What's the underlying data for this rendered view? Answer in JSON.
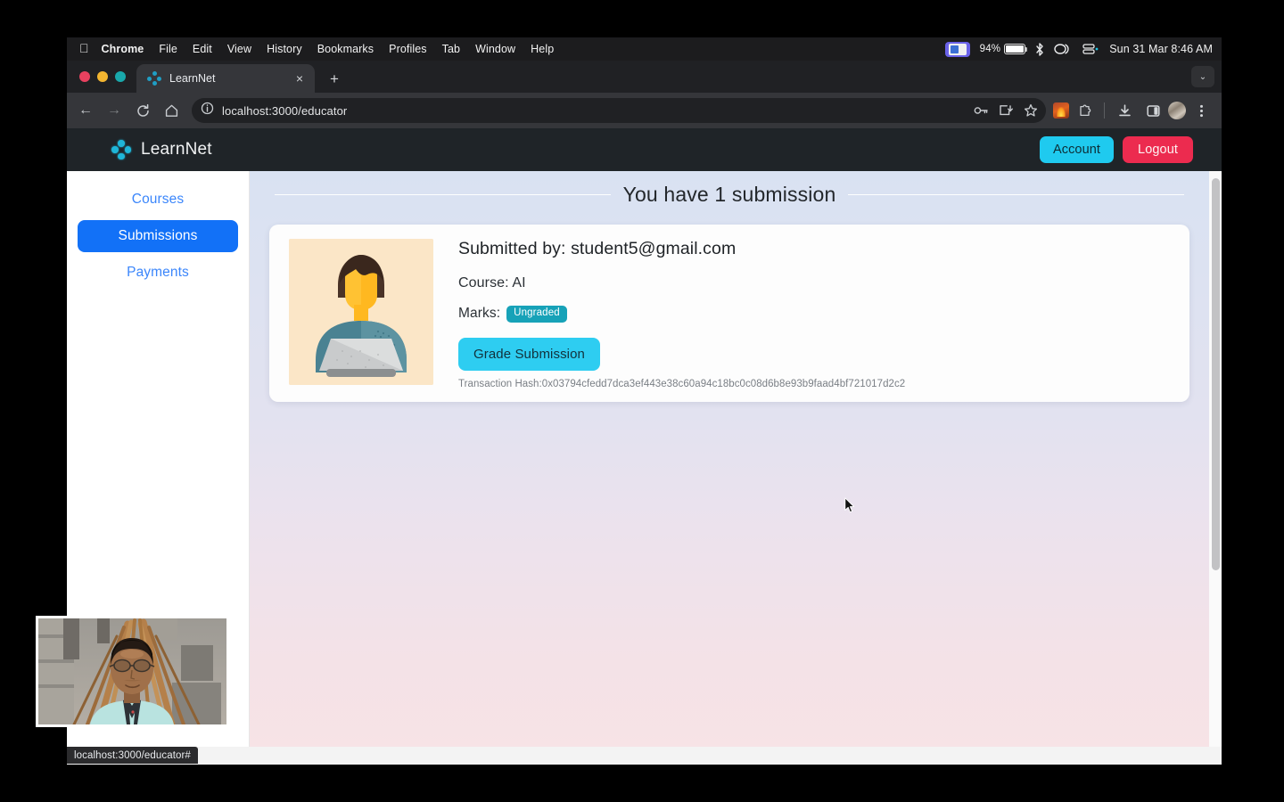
{
  "menubar": {
    "apple_icon": "apple-icon",
    "items": [
      {
        "label": "Chrome",
        "bold": true
      },
      {
        "label": "File",
        "bold": false
      },
      {
        "label": "Edit",
        "bold": false
      },
      {
        "label": "View",
        "bold": false
      },
      {
        "label": "History",
        "bold": false
      },
      {
        "label": "Bookmarks",
        "bold": false
      },
      {
        "label": "Profiles",
        "bold": false
      },
      {
        "label": "Tab",
        "bold": false
      },
      {
        "label": "Window",
        "bold": false
      },
      {
        "label": "Help",
        "bold": false
      }
    ],
    "status": {
      "screen_share_icon": "screen-record-icon",
      "battery_percent": "94%",
      "battery_icon": "battery-icon",
      "bluetooth_icon": "bluetooth-icon",
      "control_center_icon": "control-center-icon",
      "wifi_icon": "wifi-icon",
      "clock": "Sun 31 Mar  8:46 AM"
    }
  },
  "browser": {
    "traffic_lights": [
      "close",
      "minimize",
      "zoom"
    ],
    "tab": {
      "title": "LearnNet",
      "favicon": "learnnet-node-favicon",
      "close_label": "×"
    },
    "new_tab_label": "+",
    "window_caret": "⌄",
    "nav": {
      "back": "←",
      "forward": "→",
      "reload": "↻",
      "home": "⌂"
    },
    "omnibox": {
      "site_info_icon": "info-circle-icon",
      "url": "localhost:3000/educator",
      "actions": [
        "password-key-icon",
        "install-app-icon",
        "bookmark-star-icon"
      ]
    },
    "toolbar_right": [
      "extension-flame-icon",
      "extensions-puzzle-icon",
      "downloads-icon",
      "side-panel-icon",
      "profile-avatar",
      "chrome-menu-icon"
    ],
    "status_bubble": "localhost:3000/educator#"
  },
  "app": {
    "brand": {
      "name": "LearnNet",
      "logo_icon": "network-nodes-icon"
    },
    "header_actions": {
      "account_label": "Account",
      "logout_label": "Logout"
    },
    "sidebar": {
      "items": [
        {
          "label": "Courses",
          "active": false
        },
        {
          "label": "Submissions",
          "active": true
        },
        {
          "label": "Payments",
          "active": false
        }
      ]
    },
    "main": {
      "heading": "You have 1 submission",
      "submissions": [
        {
          "illustration": "student-at-laptop-illustration",
          "submitted_by_label": "Submitted by:",
          "submitted_by_value": "student5@gmail.com",
          "course_label": "Course:",
          "course_value": "AI",
          "marks_label": "Marks:",
          "marks_badge": "Ungraded",
          "grade_button_label": "Grade Submission",
          "transaction_hash_label": "Transaction Hash:",
          "transaction_hash_value": "0x03794cfedd7dca3ef443e38c60a94c18bc0c08d6b8e93b9faad4bf721017d2c2"
        }
      ]
    }
  },
  "overlay": {
    "webcam_label": "webcam-self-view"
  },
  "colors": {
    "accent_cyan": "#1fcaef",
    "logout_red": "#ec2b4f",
    "sidebar_active_blue": "#1271f7",
    "sidebar_link_blue": "#3b86fb",
    "badge_teal": "#17a2b8",
    "grade_button_cyan": "#2ecdf1",
    "header_dark": "#1f2428"
  }
}
